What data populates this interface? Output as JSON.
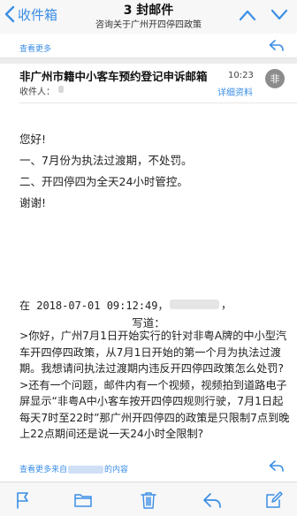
{
  "nav": {
    "back_label": "收件箱",
    "title": "3 封邮件",
    "subtitle": "咨询关于广州开四停四政策",
    "icons": [
      "chevron-left-icon",
      "chevron-up-icon",
      "chevron-down-icon"
    ]
  },
  "previous_message": {
    "more_label": "查看更多",
    "reply_icon": "reply-icon"
  },
  "email": {
    "subject": "非广州市籍中小客车预约登记申诉邮箱",
    "time": "10:23",
    "recipient_label": "收件人：",
    "details_label": "详细资料",
    "avatar_text": "非"
  },
  "body": {
    "lines": [
      "您好!",
      "一、7月份为执法过渡期，不处罚。",
      "二、开四停四为全天24小时管控。",
      "谢谢!"
    ]
  },
  "quote": {
    "date_prefix": "在  2018-07-01  09:12:49，",
    "date_suffix": "，",
    "wrote": "写道：",
    "lines": [
      ">你好，广州7月1日开始实行的针对非粤A牌的中小型汽",
      "车开四停四政策，从7月1日开始的第一个月为执法过渡",
      "期。我想请问执法过渡期内违反开四停四政策怎么处罚?",
      ">还有一个问题，邮件内有一个视频，视频拍到道路电子",
      "屏显示“非粤A中小客车按开四停四规则行驶，7月1日起",
      "每天7时至22时”那广州开四停四的政策是只限制7点到晚",
      "上22点期间还是说一天24小时全限制?"
    ],
    "more_prefix": "查看更多来自",
    "more_suffix": "的内容"
  },
  "toolbar": {
    "icons": [
      "flag-icon",
      "folder-icon",
      "trash-icon",
      "reply-icon",
      "compose-icon"
    ]
  },
  "colors": {
    "accent": "#3a8ee6",
    "avatar": "#8c8c8c",
    "bar": "#f7f7f7"
  }
}
